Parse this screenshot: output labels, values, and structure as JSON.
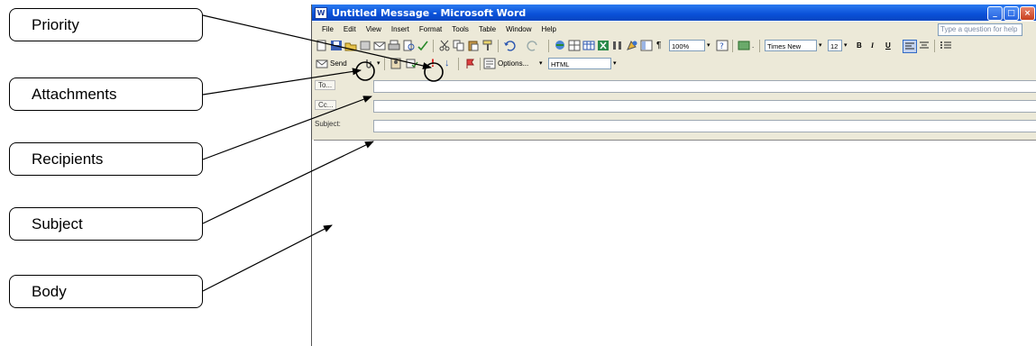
{
  "callouts": [
    {
      "label": "Priority"
    },
    {
      "label": "Attachments"
    },
    {
      "label": "Recipients"
    },
    {
      "label": "Subject"
    },
    {
      "label": "Body"
    }
  ],
  "window": {
    "title": "Untitled Message - Microsoft Word",
    "menu": [
      "File",
      "Edit",
      "View",
      "Insert",
      "Format",
      "Tools",
      "Table",
      "Window",
      "Help"
    ],
    "ask_placeholder": "Type a question for help",
    "zoom": "100%",
    "font": "Times New Roman",
    "font_size": "12",
    "options_label": "Options...",
    "format": "HTML",
    "send_label": "Send",
    "fields": {
      "to_label": "To...",
      "cc_label": "Cc...",
      "subject_label": "Subject:"
    }
  },
  "colors": {
    "titlebar": "#0a50d8",
    "toolbar": "#ece9d8",
    "priority_mark": "#e00000"
  }
}
